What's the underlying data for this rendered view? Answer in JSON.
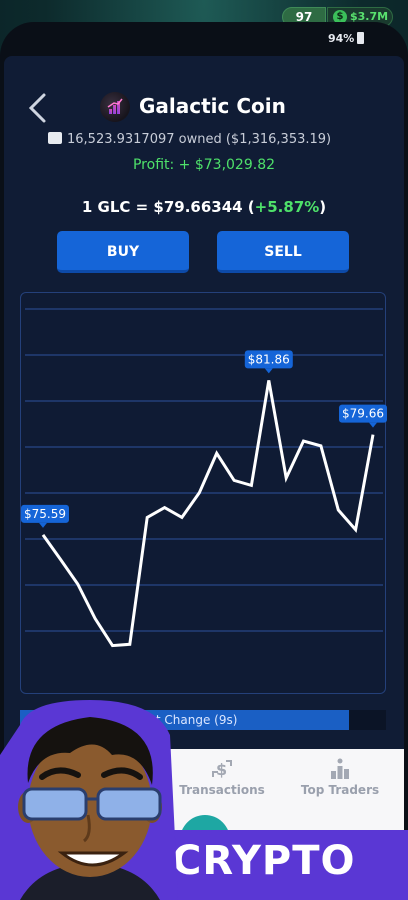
{
  "hud": {
    "level": "97",
    "money": "$3.7M",
    "battery": "94%"
  },
  "coin": {
    "name": "Galactic Coin",
    "owned_text": "16,523.9317097 owned ($1,316,353.19)",
    "profit_text": "Profit: + $73,029.82",
    "price_prefix": "1 GLC = $79.66344 (",
    "price_change": "+5.87%",
    "price_suffix": ")"
  },
  "actions": {
    "buy_label": "BUY",
    "sell_label": "SELL"
  },
  "chart_data": {
    "type": "line",
    "values": [
      75.59,
      74.6,
      73.6,
      72.2,
      71.1,
      71.15,
      76.3,
      76.7,
      76.3,
      77.3,
      78.9,
      77.8,
      77.6,
      81.86,
      77.9,
      79.4,
      79.2,
      76.6,
      75.8,
      79.66
    ],
    "labels": [
      {
        "index": 0,
        "text": "$75.59"
      },
      {
        "index": 13,
        "text": "$81.86"
      },
      {
        "index": 19,
        "text": "$79.66"
      }
    ],
    "ylim": [
      69.5,
      85.0
    ],
    "grid": true,
    "line_color": "#ffffff"
  },
  "progress": {
    "label": "Next Change (9s)",
    "fraction": 0.9
  },
  "tabs": {
    "transactions": "Transactions",
    "top_traders": "Top Traders"
  },
  "banner": {
    "text": "CRYPTO"
  }
}
